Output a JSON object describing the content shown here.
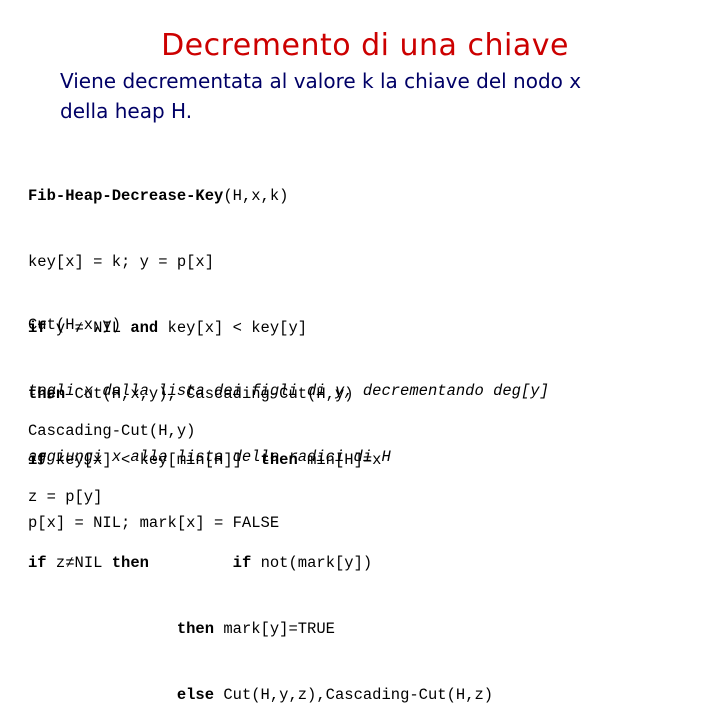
{
  "slide": {
    "title": "Decremento di una chiave",
    "subtitle_line1": "Viene decrementata al valore k la chiave del nodo x",
    "subtitle_line2": "della heap H.",
    "colors": {
      "title": "#cc0000",
      "subtitle": "#000066",
      "code": "#000000"
    }
  },
  "decrease_key": {
    "l0_name": "Fib-Heap-Decrease-Key",
    "l0_args": "(H,x,k)",
    "l1": "key[x] = k; y = p[x]",
    "l2_kw1": "if",
    "l2_a": " y ≠ NIL ",
    "l2_kw2": "and",
    "l2_b": " key[x] < key[y]",
    "l3_kw": "then",
    "l3_rest": " Cut(H,x,y), Cascading-Cut(H,y)",
    "l4_kw1": "if",
    "l4_a": " key[x] < key[min[H]]  ",
    "l4_kw2": "then",
    "l4_b": " min[H]=x"
  },
  "cut": {
    "l0": "Cut(H,x,y)",
    "l1": "togli x dalla lista dei figli di y, decrementando deg[y]",
    "l2": "aggiungi x alla lista delle radici di H",
    "l3": "p[x] = NIL; mark[x] = FALSE"
  },
  "cascading_cut": {
    "l0": "Cascading-Cut(H,y)",
    "l1": "z = p[y]",
    "l2_kw1": "if",
    "l2_a": " z≠NIL ",
    "l2_kw2": "then",
    "l2_pad": "         ",
    "l2_kw3": "if",
    "l2_b": " not(mark[y])",
    "l3_pad": "                ",
    "l3_kw": "then",
    "l3_rest": " mark[y]=TRUE",
    "l4_pad": "                ",
    "l4_kw": "else",
    "l4_rest": " Cut(H,y,z),Cascading-Cut(H,z)"
  }
}
